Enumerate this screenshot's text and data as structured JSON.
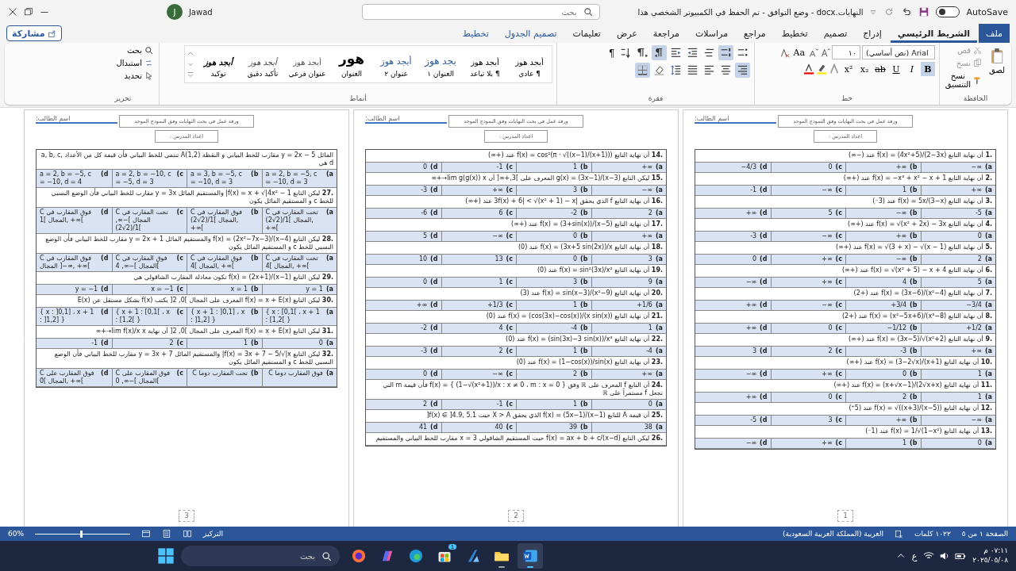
{
  "title_bar": {
    "autosave": {
      "label": "AutoSave",
      "on": false
    },
    "title": "النهايات.docx  -  وضع التوافق  -  تم الحفظ في الكمبيوتر الشخصي هذا",
    "search": {
      "placeholder": "بحث"
    },
    "user": {
      "initial": "J",
      "name": "Jawad"
    }
  },
  "tabs": [
    {
      "label": "ملف",
      "kind": "file",
      "selected": false
    },
    {
      "label": "الشريط الرئيسي",
      "kind": "normal",
      "selected": true
    },
    {
      "label": "إدراج",
      "kind": "normal",
      "selected": false
    },
    {
      "label": "تصميم",
      "kind": "normal",
      "selected": false
    },
    {
      "label": "تخطيط",
      "kind": "normal",
      "selected": false
    },
    {
      "label": "مراجع",
      "kind": "normal",
      "selected": false
    },
    {
      "label": "مراسلات",
      "kind": "normal",
      "selected": false
    },
    {
      "label": "مراجعة",
      "kind": "normal",
      "selected": false
    },
    {
      "label": "عرض",
      "kind": "normal",
      "selected": false
    },
    {
      "label": "تعليمات",
      "kind": "normal",
      "selected": false
    },
    {
      "label": "تصميم الجدول",
      "kind": "contextual",
      "selected": false
    },
    {
      "label": "تخطيط",
      "kind": "contextual",
      "selected": false
    }
  ],
  "share_button": "مشاركة",
  "ribbon": {
    "clipboard": {
      "label": "الحافظة",
      "paste": "لصق",
      "cut": "قص",
      "copy": "نسخ",
      "format_painter": "نسخ التنسيق"
    },
    "font": {
      "label": "خط",
      "font_name": "(نص أساسي) Arial",
      "font_size": "١٠",
      "case_button": "Aa",
      "buttons": [
        {
          "text": "B",
          "kind": "bold",
          "selected": true
        },
        {
          "text": "I",
          "kind": "italic",
          "selected": false
        },
        {
          "text": "U",
          "kind": "underline",
          "selected": false
        },
        {
          "text": "ab",
          "kind": "strike",
          "selected": false
        },
        {
          "text": "x₂",
          "kind": "sub",
          "selected": false
        },
        {
          "text": "x²",
          "kind": "sup",
          "selected": false
        }
      ]
    },
    "paragraph": {
      "label": "فقرة",
      "pilcrow": "¶",
      "row_1": [
        {
          "kind": "bullets",
          "selected": false
        },
        {
          "kind": "numbering",
          "selected": true
        },
        {
          "kind": "multilevel",
          "selected": false
        },
        {
          "kind": "outdent",
          "selected": false
        },
        {
          "kind": "indent",
          "selected": false
        },
        {
          "kind": "rtl",
          "selected": true
        },
        {
          "kind": "ltr",
          "selected": false
        },
        {
          "kind": "sort",
          "selected": false
        }
      ],
      "row_2": [
        {
          "kind": "align-right",
          "selected": true
        },
        {
          "kind": "center",
          "selected": false
        },
        {
          "kind": "align-left",
          "selected": false
        },
        {
          "kind": "justify",
          "selected": false
        },
        {
          "kind": "spacing",
          "selected": false
        },
        {
          "kind": "shading",
          "selected": false
        },
        {
          "kind": "borders",
          "selected": true
        }
      ]
    },
    "styles": {
      "label": "أنماط",
      "items": [
        {
          "preview": "أبجد هوز",
          "name": "¶ عادي",
          "kind": "normal"
        },
        {
          "preview": "أبجد هوز",
          "name": "¶ بلا تباعد",
          "kind": "normal"
        },
        {
          "preview": "بجد هوز",
          "name": "العنوان ١",
          "kind": "heading1"
        },
        {
          "preview": "أبجد هوز",
          "name": "عنوان ٢",
          "kind": "heading2"
        },
        {
          "preview": "هور",
          "name": "العنوان",
          "kind": "title"
        },
        {
          "preview": "أبجد هوز",
          "name": "عنوان فرعي",
          "kind": "subtitle"
        },
        {
          "preview": "أبجد هوز",
          "name": "تأكيد دقيق",
          "kind": "emphasis"
        },
        {
          "preview": "أبجد هوز",
          "name": "توكيد",
          "kind": "strong"
        }
      ]
    },
    "editing": {
      "label": "تحرير",
      "find": "بحث",
      "replace": "استبدال",
      "select": "تحديد"
    }
  },
  "pages": [
    {
      "number": "1",
      "student_label": "اسم الطالب:",
      "title": "ورقة عمل في بحث النهايات وفق النموذج الموحد",
      "author": "اعداد المدرس :",
      "questions": [
        {
          "number": "1.",
          "stem": "أن نهاية التابع f(x) = (4x²+5)/(2−3x) عند (−∞)",
          "options": [
            {
              "label": "(a",
              "value": "−∞"
            },
            {
              "label": "(b",
              "value": "+∞"
            },
            {
              "label": "(c",
              "value": "0"
            },
            {
              "label": "(d",
              "value": "−4/3"
            }
          ]
        },
        {
          "number": "2.",
          "stem": "أن نهاية التابع f(x) = −x³ + x² − x + 1 عند (+∞)",
          "options": [
            {
              "label": "(a",
              "value": "+∞"
            },
            {
              "label": "(b",
              "value": "1"
            },
            {
              "label": "(c",
              "value": "−∞"
            },
            {
              "label": "(d",
              "value": "-1"
            }
          ]
        },
        {
          "number": "3.",
          "stem": "أن نهاية التابع f(x) = 5x/(3−x) عند (3⁻)",
          "options": [
            {
              "label": "(a",
              "value": "-5"
            },
            {
              "label": "(b",
              "value": "−∞"
            },
            {
              "label": "(c",
              "value": "5"
            },
            {
              "label": "(d",
              "value": "+∞"
            }
          ]
        },
        {
          "number": "4.",
          "stem": "أن نهاية التابع f(x) = √(x² + 2x) − 3x عند (+∞)",
          "options": [
            {
              "label": "(a",
              "value": "0"
            },
            {
              "label": "(b",
              "value": "+∞"
            },
            {
              "label": "(c",
              "value": "−∞"
            },
            {
              "label": "(d",
              "value": "-3"
            }
          ]
        },
        {
          "number": "5.",
          "stem": "أن نهاية التابع f(x) = √(3 + x) − √(x − 1) عند (+∞)",
          "options": [
            {
              "label": "(a",
              "value": "2"
            },
            {
              "label": "(b",
              "value": "−∞"
            },
            {
              "label": "(c",
              "value": "+∞"
            },
            {
              "label": "(d",
              "value": "0"
            }
          ]
        },
        {
          "number": "6.",
          "stem": "أن نهاية التابع f(x) = √(x² + 5) − x + 4 عند (+∞)",
          "options": [
            {
              "label": "(a",
              "value": "5"
            },
            {
              "label": "(b",
              "value": "4"
            },
            {
              "label": "(c",
              "value": "+∞"
            },
            {
              "label": "(d",
              "value": "−∞"
            }
          ]
        },
        {
          "number": "7.",
          "stem": "أن نهاية التابع f(x) = (3x−6)/(x²−4) عند (+2)",
          "options": [
            {
              "label": "(a",
              "value": "−3/4"
            },
            {
              "label": "(b",
              "value": "+3/4"
            },
            {
              "label": "(c",
              "value": "−∞"
            },
            {
              "label": "(d",
              "value": "+∞"
            }
          ]
        },
        {
          "number": "8.",
          "stem": "أن نهاية التابع f(x) = (x²−5x+6)/(x³−8) عند (+2)",
          "options": [
            {
              "label": "(a",
              "value": "+1/2"
            },
            {
              "label": "(b",
              "value": "−1/12"
            },
            {
              "label": "(c",
              "value": "0"
            },
            {
              "label": "(d",
              "value": "+∞"
            }
          ]
        },
        {
          "number": "9.",
          "stem": "أن نهاية التابع f(x) = (3x−5)/√(x²+2) عند (+∞)",
          "options": [
            {
              "label": "(a",
              "value": "+∞"
            },
            {
              "label": "(b",
              "value": "-3"
            },
            {
              "label": "(c",
              "value": "2"
            },
            {
              "label": "(d",
              "value": "3"
            }
          ]
        },
        {
          "number": "10.",
          "stem": "أن نهاية التابع f(x) = (3−2√x)/(x+1) عند (+∞)",
          "options": [
            {
              "label": "(a",
              "value": "1"
            },
            {
              "label": "(b",
              "value": "0"
            },
            {
              "label": "(c",
              "value": "+∞"
            },
            {
              "label": "(d",
              "value": "−∞"
            }
          ]
        },
        {
          "number": "11.",
          "stem": "أن نهاية التابع f(x) = (x+√x−1)/(2√x+x) عند (+∞)",
          "options": [
            {
              "label": "(a",
              "value": "1"
            },
            {
              "label": "(b",
              "value": "2"
            },
            {
              "label": "(c",
              "value": "0"
            },
            {
              "label": "(d",
              "value": "+∞"
            }
          ]
        },
        {
          "number": "12.",
          "stem": "أن نهاية التابع f(x) = √((x+3)/(x−5)) عند (5⁺)",
          "options": [
            {
              "label": "(a",
              "value": "−∞"
            },
            {
              "label": "(b",
              "value": "+∞"
            },
            {
              "label": "(c",
              "value": "3"
            },
            {
              "label": "(d",
              "value": "-5"
            }
          ]
        },
        {
          "number": "13.",
          "stem": "أن نهاية التابع f(x) = 1/√(1−x²) عند (1⁻)",
          "options": [
            {
              "label": "(a",
              "value": "0"
            },
            {
              "label": "(b",
              "value": "1"
            },
            {
              "label": "(c",
              "value": "+∞"
            },
            {
              "label": "(d",
              "value": "−∞"
            }
          ]
        }
      ]
    },
    {
      "number": "2",
      "student_label": "اسم الطالب:",
      "title": "ورقة عمل في بحث النهايات وفق النموذج الموحد",
      "author": "اعداد المدرس :",
      "questions": [
        {
          "number": "14.",
          "stem": "أن نهاية التابع f(x) = cos²(π · √((x−1)/(x+1))) عند (+∞)",
          "options": [
            {
              "label": "(a",
              "value": "+∞"
            },
            {
              "label": "(b",
              "value": "1"
            },
            {
              "label": "(c",
              "value": "-1"
            },
            {
              "label": "(d",
              "value": "0"
            }
          ]
        },
        {
          "number": "15.",
          "stem": "ليكن التابع g(x) = (3x−1)/(x−3) المعرف على ]3,+∞[ أن lim g(g(x)) x→+∞",
          "options": [
            {
              "label": "(a",
              "value": "−∞"
            },
            {
              "label": "(b",
              "value": "3"
            },
            {
              "label": "(c",
              "value": "+∞"
            },
            {
              "label": "(d",
              "value": "-3"
            }
          ]
        },
        {
          "number": "16.",
          "stem": "أن نهاية التابع f الذي يحقق |3f(x) + 6| < √(x² + 1) − x عند (+∞)",
          "options": [
            {
              "label": "(a",
              "value": "2"
            },
            {
              "label": "(b",
              "value": "-2"
            },
            {
              "label": "(c",
              "value": "6"
            },
            {
              "label": "(d",
              "value": "-6"
            }
          ]
        },
        {
          "number": "17.",
          "stem": "أن نهاية التابع f(x) = (3+sin(x))/(x−5) عند (+∞)",
          "options": [
            {
              "label": "(a",
              "value": "+∞"
            },
            {
              "label": "(b",
              "value": "0"
            },
            {
              "label": "(c",
              "value": "−∞"
            },
            {
              "label": "(d",
              "value": "5"
            }
          ]
        },
        {
          "number": "18.",
          "stem": "أن نهاية التابع f(x) = (3x+5 sin(2x))/x عند (0)",
          "options": [
            {
              "label": "(a",
              "value": "3"
            },
            {
              "label": "(b",
              "value": "0"
            },
            {
              "label": "(c",
              "value": "13"
            },
            {
              "label": "(d",
              "value": "10"
            }
          ]
        },
        {
          "number": "19.",
          "stem": "أن نهاية التابع f(x) = sin²(3x)/x² عند (0)",
          "options": [
            {
              "label": "(a",
              "value": "9"
            },
            {
              "label": "(b",
              "value": "3"
            },
            {
              "label": "(c",
              "value": "1"
            },
            {
              "label": "(d",
              "value": "0"
            }
          ]
        },
        {
          "number": "20.",
          "stem": "أن نهاية التابع f(x) = sin(x−3)/(x²−9) عند (3)",
          "options": [
            {
              "label": "(a",
              "value": "+1/6"
            },
            {
              "label": "(b",
              "value": "1"
            },
            {
              "label": "(c",
              "value": "+1/3"
            },
            {
              "label": "(d",
              "value": "+∞"
            }
          ]
        },
        {
          "number": "21.",
          "stem": "أن نهاية التابع f(x) = (cos(3x)−cos(x))/(x sin(x)) عند (0)",
          "options": [
            {
              "label": "(a",
              "value": "1"
            },
            {
              "label": "(b",
              "value": "-4"
            },
            {
              "label": "(c",
              "value": "4"
            },
            {
              "label": "(d",
              "value": "-2"
            }
          ]
        },
        {
          "number": "22.",
          "stem": "أن نهاية التابع f(x) = (sin(3x)−3 sin(x))/x³ عند (0)",
          "options": [
            {
              "label": "(a",
              "value": "-4"
            },
            {
              "label": "(b",
              "value": "1"
            },
            {
              "label": "(c",
              "value": "2"
            },
            {
              "label": "(d",
              "value": "-3"
            }
          ]
        },
        {
          "number": "23.",
          "stem": "أن نهاية التابع f(x) = (1−cos(x))/sin(x) عند (0)",
          "options": [
            {
              "label": "(a",
              "value": "+∞"
            },
            {
              "label": "(b",
              "value": "2"
            },
            {
              "label": "(c",
              "value": "−∞"
            },
            {
              "label": "(d",
              "value": "0"
            }
          ]
        },
        {
          "number": "24.",
          "stem": "أن التابع f المعرف على ℝ وفق f(x) = { (1−√(x²+1))/x : x ≠ 0 ، m : x = 0 } فأن قيمة m التي تجعل f مستمراً على ℝ",
          "options": [
            {
              "label": "(a",
              "value": "0"
            },
            {
              "label": "(b",
              "value": "1"
            },
            {
              "label": "(c",
              "value": "-1"
            },
            {
              "label": "(d",
              "value": "2"
            }
          ]
        },
        {
          "number": "25.",
          "stem": "أن قيمة A للتابع f(x) = (5x−1)/(x−1) الذي يحقق X > A حيث f(x) ∈ ]4.9, 5.1[",
          "options": [
            {
              "label": "(a",
              "value": "38"
            },
            {
              "label": "(b",
              "value": "39"
            },
            {
              "label": "(c",
              "value": "40"
            },
            {
              "label": "(d",
              "value": "41"
            }
          ]
        },
        {
          "number": "26.",
          "stem": "ليكن التابع f(x) = ax + b + c/(x−d) حيث المستقيم الشاقولي x = 3 مقارب للخط البياني والمستقيم"
        }
      ]
    },
    {
      "number": "3",
      "student_label": "اسم الطالب:",
      "title": "ورقة عمل في بحث النهايات وفق النموذج الموحد",
      "author": "اعداد المدرس :",
      "questions": [
        {
          "stem": "المائل y = 2x − 5 مقارب للخط البياني و النقطة A(1,2) تنتمي للخط البياني فأن قيمة كل من الأعداد a, b, c, d هي",
          "options": [
            {
              "label": "(a",
              "value": "a = 2, b = −5, c = −10, d = 3"
            },
            {
              "label": "(b",
              "value": "a = 3, b = −5, c = −10, d = 3"
            },
            {
              "label": "(c",
              "value": "a = 2, b = −10, c = −5, d = 3"
            },
            {
              "label": "(d",
              "value": "a = 2, b = −5, c = −10, d = 4"
            }
          ]
        },
        {
          "number": "27.",
          "stem": "ليكن التابع f(x) = x + √|4x² − 1| والمستقيم المائل y = 3x مقارب للخط البياني فأن الوضع النسبي للخط c و المستقيم المائل يكون",
          "options": [
            {
              "label": "(a",
              "value": "C تحت المقارب في المجال ]1/(2√2), +∞["
            },
            {
              "label": "(b",
              "value": "C فوق المقارب في المجال ]1/(2√2), +∞["
            },
            {
              "label": "(c",
              "value": "C تحت المقارب في المجال ]−∞, 1/(2√2)["
            },
            {
              "label": "(d",
              "value": "C فوق المقارب في المجال ]1, +∞["
            }
          ]
        },
        {
          "number": "28.",
          "stem": "ليكن التابع f(x) = (2x²−7x−3)/(x−4) والمستقيم المائل y = 2x + 1 مقارب للخط البياني فأن الوضع النسبي للخط c و المستقيم المائل يكون",
          "options": [
            {
              "label": "(a",
              "value": "C تحت المقارب في المجال ]4, +∞["
            },
            {
              "label": "(b",
              "value": "C فوق المقارب في المجال ]4, +∞["
            },
            {
              "label": "(c",
              "value": "C فوق المقارب في المجال ]−∞, 4["
            },
            {
              "label": "(d",
              "value": "C فوق المقارب في المجال ]−∞, +∞["
            }
          ]
        },
        {
          "number": "29.",
          "stem": "ليكن التابع f(x) = (2x+1)/(x−1) تكون معادلة المقارب الشاقولي هي",
          "options": [
            {
              "label": "(a",
              "value": "y = 1"
            },
            {
              "label": "(b",
              "value": "x = 1"
            },
            {
              "label": "(c",
              "value": "x = −1"
            },
            {
              "label": "(d",
              "value": "y = −1"
            }
          ]
        },
        {
          "number": "30.",
          "stem": "ليكن التابع f(x) = x + E(x) المعرف على المجال ]0, 2[ يكتب f(x) بشكل مستقل عن E(x)",
          "options": [
            {
              "label": "(a",
              "value": "{ x : [0,1[ ، x + 1 : [1,2[ }"
            },
            {
              "label": "(b",
              "value": "{ x + 1 : ]0,1] ، x : ]1,2] }"
            },
            {
              "label": "(c",
              "value": "{ x + 1 : [0,1[ ، x : [1,2[ }"
            },
            {
              "label": "(d",
              "value": "{ x : ]0,1] ، x + 1 : ]1,2] }"
            }
          ]
        },
        {
          "number": "31.",
          "stem": "ليكن التابع f(x) = x + E(x) المعرف على المجال ]0, 2[ أن نهاية lim f(x)/x x→+∞",
          "options": [
            {
              "label": "(a",
              "value": "0"
            },
            {
              "label": "(b",
              "value": "1"
            },
            {
              "label": "(c",
              "value": "2"
            },
            {
              "label": "(d",
              "value": "-1"
            }
          ]
        },
        {
          "number": "32.",
          "stem": "ليكن التابع f(x) = 3x + 7 − 5/√|x| والمستقيم المائل y = 3x + 7 مقارب للخط البياني فأن الوضع النسبي للخط c و المستقيم المائل يكون",
          "options": [
            {
              "label": "(a",
              "value": "C فوق المقارب دوما"
            },
            {
              "label": "(b",
              "value": "C تحت المقارب دوما"
            },
            {
              "label": "(c",
              "value": "C فوق المقارب على المجال ]−∞, 0["
            },
            {
              "label": "(d",
              "value": "C فوق المقارب على المجال ]0, +∞["
            }
          ]
        }
      ]
    }
  ],
  "status_bar": {
    "page": "الصفحة ١ من ٥",
    "words": "١٠٢٢ كلمات",
    "language": "العربية (المملكة العربية السعودية)",
    "focus": "التركيز",
    "zoom": {
      "level": 0.5,
      "reading": "60%"
    }
  },
  "taskbar": {
    "search": {
      "placeholder": "بحث"
    },
    "apps": [
      {
        "kind": "word",
        "running": true,
        "selected": true
      },
      {
        "kind": "folder",
        "running": true,
        "selected": false
      },
      {
        "kind": "pen",
        "running": false,
        "selected": false
      },
      {
        "kind": "store",
        "running": false,
        "selected": false,
        "badge": "1"
      },
      {
        "kind": "edge",
        "running": false,
        "selected": false
      },
      {
        "kind": "copilot",
        "running": false,
        "selected": false
      },
      {
        "kind": "firefox",
        "running": false,
        "selected": false
      }
    ],
    "keyboard": "ع",
    "time": "٠٧:١١ م",
    "date": "٢٠٢٥/٠٥/٠٨"
  }
}
